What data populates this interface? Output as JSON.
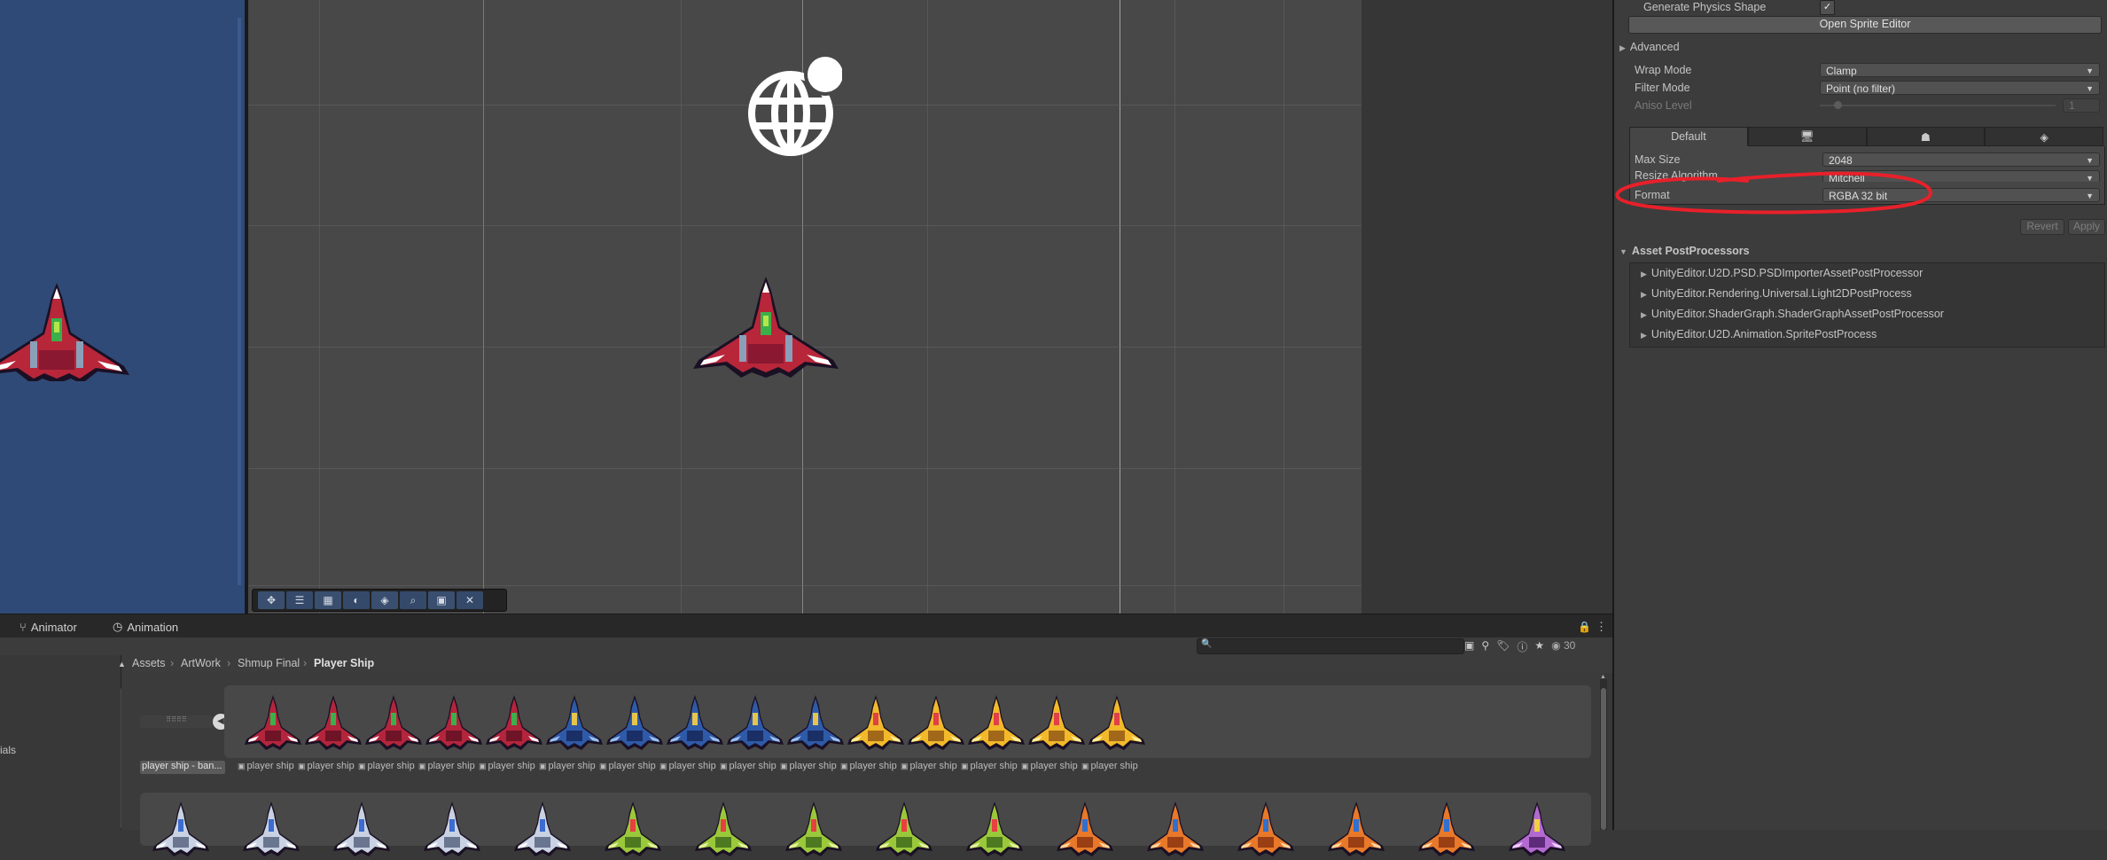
{
  "inspector": {
    "generate_physics_shape_label": "Generate Physics Shape",
    "generate_physics_shape_checked": "✓",
    "open_sprite_editor_label": "Open Sprite Editor",
    "advanced_label": "Advanced",
    "wrap_mode_label": "Wrap Mode",
    "wrap_mode_value": "Clamp",
    "filter_mode_label": "Filter Mode",
    "filter_mode_value": "Point (no filter)",
    "aniso_level_label": "Aniso Level",
    "aniso_level_value": "1",
    "platform_tabs": [
      "Default",
      "",
      "",
      ""
    ],
    "max_size_label": "Max Size",
    "max_size_value": "2048",
    "resize_algorithm_label": "Resize Algorithm",
    "resize_algorithm_value": "Mitchell",
    "format_label": "Format",
    "format_value": "RGBA 32 bit",
    "revert_label": "Revert",
    "apply_label": "Apply",
    "asset_postprocessors_label": "Asset PostProcessors",
    "postprocessors": [
      "UnityEditor.U2D.PSD.PSDImporterAssetPostProcessor",
      "UnityEditor.Rendering.Universal.Light2DPostProcess",
      "UnityEditor.ShaderGraph.ShaderGraphAssetPostProcessor",
      "UnityEditor.U2D.Animation.SpritePostProcess"
    ]
  },
  "bottom_tabs": {
    "animator_label": "Animator",
    "animation_label": "Animation"
  },
  "project": {
    "visible_count": "30",
    "left_tree_fragment": "ials",
    "breadcrumb": [
      "Assets",
      "ArtWork",
      "Shmup Final",
      "Player Ship"
    ],
    "selected_label": "player ship - ban...",
    "item_label": "player ship - ...",
    "row1_colors": [
      "red",
      "red",
      "red",
      "red",
      "red",
      "blue",
      "blue",
      "blue",
      "blue",
      "blue",
      "yellow",
      "yellow",
      "yellow",
      "yellow",
      "yellow"
    ],
    "row2_colors": [
      "white",
      "white",
      "white",
      "white",
      "white",
      "green",
      "green",
      "green",
      "green",
      "green",
      "orange",
      "orange",
      "orange",
      "orange",
      "orange",
      "purple"
    ]
  },
  "colors": {
    "annotation_red": "#e8202a",
    "game_view_blue": "#2f4a77"
  }
}
